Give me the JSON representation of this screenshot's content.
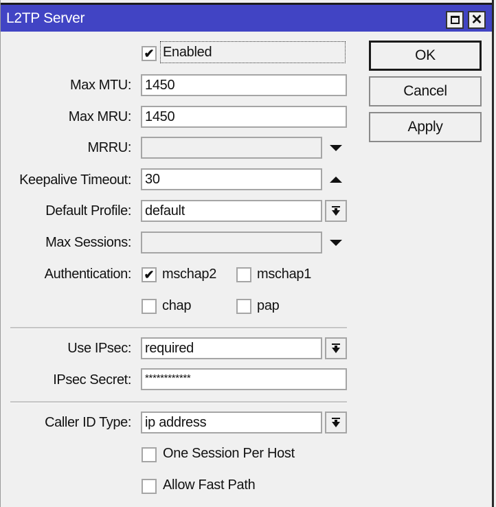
{
  "window": {
    "title": "L2TP Server",
    "maximize_icon": "maximize-icon",
    "close_icon": "close-icon",
    "title_bar_color": "#4144c4"
  },
  "buttons": {
    "ok": "OK",
    "cancel": "Cancel",
    "apply": "Apply"
  },
  "enabled": {
    "label": "Enabled",
    "checked": true
  },
  "fields": {
    "max_mtu": {
      "label": "Max MTU:",
      "value": "1450"
    },
    "max_mru": {
      "label": "Max MRU:",
      "value": "1450"
    },
    "mrru": {
      "label": "MRRU:",
      "value": "",
      "toggle_icon": "expand-down-icon"
    },
    "keepalive_timeout": {
      "label": "Keepalive Timeout:",
      "value": "30",
      "toggle_icon": "collapse-up-icon"
    },
    "default_profile": {
      "label": "Default Profile:",
      "value": "default",
      "dropdown_icon": "dropdown-icon"
    },
    "max_sessions": {
      "label": "Max Sessions:",
      "value": "",
      "toggle_icon": "expand-down-icon"
    },
    "use_ipsec": {
      "label": "Use IPsec:",
      "value": "required",
      "dropdown_icon": "dropdown-icon"
    },
    "ipsec_secret": {
      "label": "IPsec Secret:",
      "value": "************"
    },
    "caller_id_type": {
      "label": "Caller ID Type:",
      "value": "ip address",
      "dropdown_icon": "dropdown-icon"
    }
  },
  "authentication": {
    "label": "Authentication:",
    "options": [
      {
        "label": "mschap2",
        "checked": true
      },
      {
        "label": "mschap1",
        "checked": false
      },
      {
        "label": "chap",
        "checked": false
      },
      {
        "label": "pap",
        "checked": false
      }
    ]
  },
  "options": {
    "one_session_per_host": {
      "label": "One Session Per Host",
      "checked": false
    },
    "allow_fast_path": {
      "label": "Allow Fast Path",
      "checked": false
    }
  },
  "checkmark_glyph": "✔"
}
